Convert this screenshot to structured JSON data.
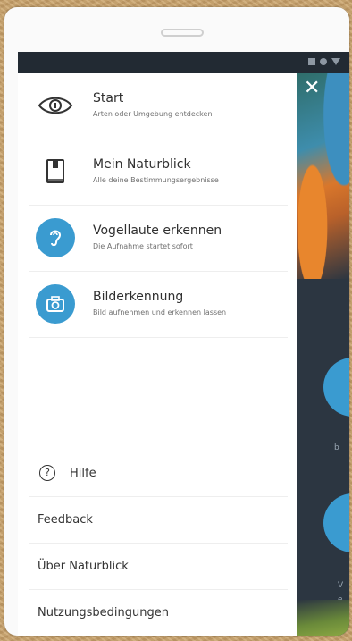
{
  "drawer": {
    "items": [
      {
        "title": "Start",
        "subtitle": "Arten oder Umgebung entdecken",
        "icon": "eye-icon"
      },
      {
        "title": "Mein Naturblick",
        "subtitle": "Alle deine Bestimmungsergebnisse",
        "icon": "book-icon"
      },
      {
        "title": "Vogellaute erkennen",
        "subtitle": "Die Aufnahme startet sofort",
        "icon": "ear-icon"
      },
      {
        "title": "Bilderkennung",
        "subtitle": "Bild aufnehmen und erkennen lassen",
        "icon": "camera-icon"
      }
    ],
    "footer": [
      {
        "label": "Hilfe",
        "icon": "help-icon"
      },
      {
        "label": "Feedback"
      },
      {
        "label": "Über Naturblick"
      },
      {
        "label": "Nutzungsbedingungen"
      }
    ]
  },
  "close_label": "✕",
  "background_labels": [
    "b",
    "V",
    "e"
  ],
  "colors": {
    "accent": "#3a9bd0",
    "statusbar": "#222a33",
    "app_background": "#2b3440"
  }
}
